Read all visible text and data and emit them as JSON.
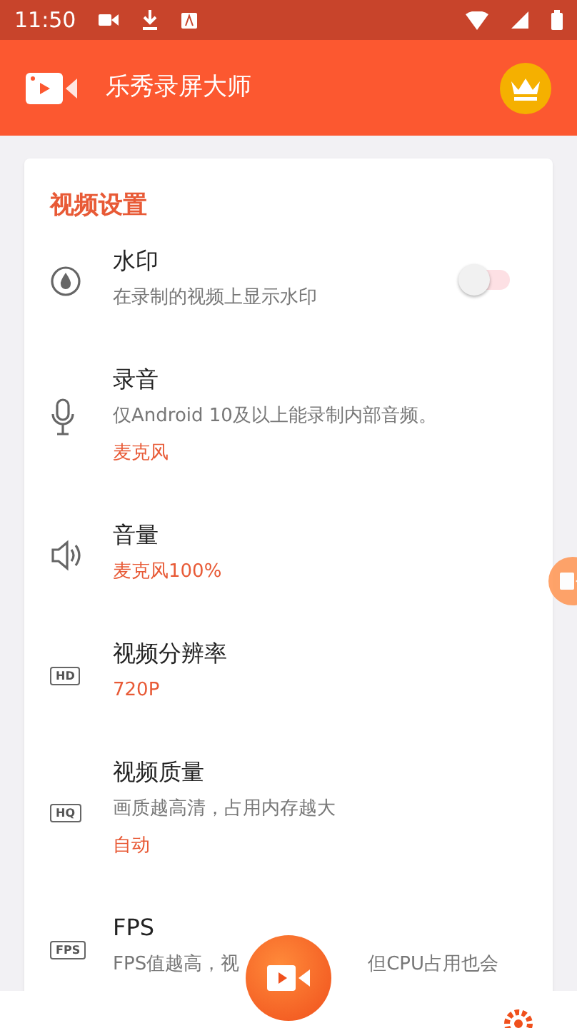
{
  "status_bar": {
    "time": "11:50"
  },
  "app_bar": {
    "title": "乐秀录屏大师"
  },
  "settings_card": {
    "title": "视频设置",
    "items": [
      {
        "kind": "toggle",
        "title": "水印",
        "description": "在录制的视频上显示水印",
        "on": false
      },
      {
        "kind": "microphone",
        "title": "录音",
        "description": "仅Android 10及以上能录制内部音频。",
        "value": "麦克风"
      },
      {
        "kind": "speaker",
        "title": "音量",
        "value": "麦克风100%"
      },
      {
        "kind": "badge",
        "badge": "HD",
        "title": "视频分辨率",
        "value": "720P"
      },
      {
        "kind": "badge",
        "badge": "HQ",
        "title": "视频质量",
        "description": "画质越高清，占用内存越大",
        "value": "自动"
      },
      {
        "kind": "badge",
        "badge": "FPS",
        "title": "FPS",
        "description_parts": [
          "FPS值越高，视",
          "但CPU占用也会"
        ]
      }
    ]
  }
}
